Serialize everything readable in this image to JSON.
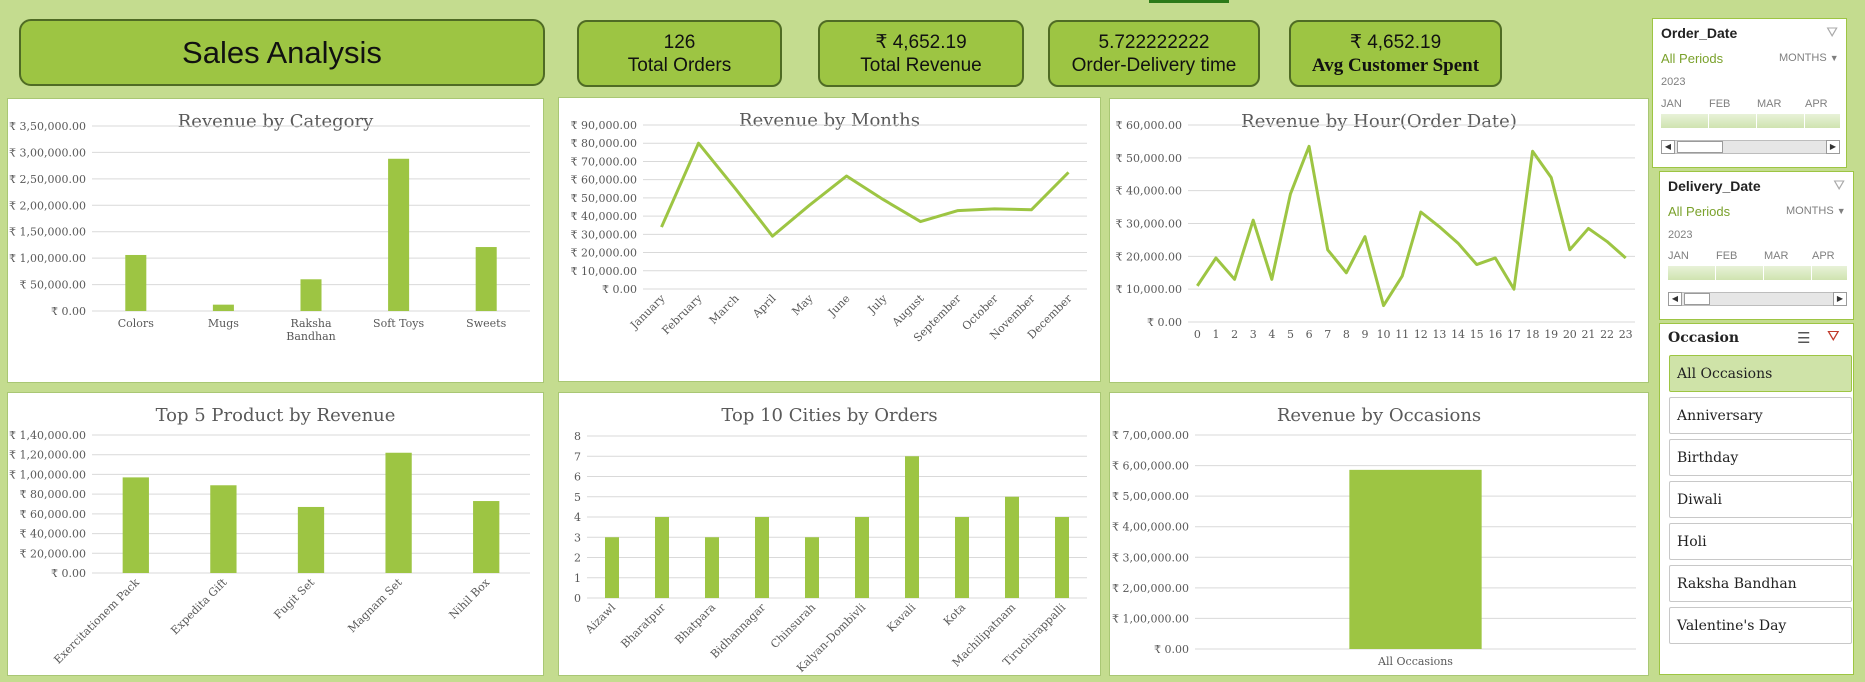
{
  "dashboard": {
    "title": "Sales Analysis"
  },
  "kpis": [
    {
      "value": "126",
      "label": "Total Orders"
    },
    {
      "value": "₹ 4,652.19",
      "label": "Total Revenue"
    },
    {
      "value": "5.722222222",
      "label": "Order-Delivery time"
    },
    {
      "value": "₹ 4,652.19",
      "label": "Avg Customer Spent"
    }
  ],
  "slicers": {
    "order_date": {
      "title": "Order_Date",
      "periods": "All Periods",
      "level": "MONTHS",
      "year": "2023",
      "months": [
        "JAN",
        "FEB",
        "MAR",
        "APR"
      ]
    },
    "delivery_date": {
      "title": "Delivery_Date",
      "periods": "All Periods",
      "level": "MONTHS",
      "year": "2023",
      "months": [
        "JAN",
        "FEB",
        "MAR",
        "APR"
      ]
    },
    "occasion": {
      "title": "Occasion",
      "items": [
        "All Occasions",
        "Anniversary",
        "Birthday",
        "Diwali",
        "Holi",
        "Raksha Bandhan",
        "Valentine's Day"
      ],
      "selected": "All Occasions"
    }
  },
  "colors": {
    "accent": "#9dc543",
    "background": "#c4dc8f",
    "border": "#4f6b24"
  },
  "chart_data": [
    {
      "id": "category",
      "type": "bar",
      "title": "Revenue by Category",
      "categories": [
        "Colors",
        "Mugs",
        "Raksha Bandhan",
        "Soft Toys",
        "Sweets"
      ],
      "values": [
        106000,
        12000,
        60000,
        288000,
        121000
      ],
      "yticks": [
        "₹ 0.00",
        "₹ 50,000.00",
        "₹ 1,00,000.00",
        "₹ 1,50,000.00",
        "₹ 2,00,000.00",
        "₹ 2,50,000.00",
        "₹ 3,00,000.00",
        "₹ 3,50,000.00"
      ],
      "ylim": [
        0,
        350000
      ]
    },
    {
      "id": "months",
      "type": "line",
      "title": "Revenue by Months",
      "categories": [
        "January",
        "February",
        "March",
        "April",
        "May",
        "June",
        "July",
        "August",
        "September",
        "October",
        "November",
        "December"
      ],
      "values": [
        34000,
        80000,
        55000,
        29000,
        46000,
        62000,
        49000,
        37000,
        43000,
        44000,
        43500,
        64000
      ],
      "yticks": [
        "₹ 0.00",
        "₹ 10,000.00",
        "₹ 20,000.00",
        "₹ 30,000.00",
        "₹ 40,000.00",
        "₹ 50,000.00",
        "₹ 60,000.00",
        "₹ 70,000.00",
        "₹ 80,000.00",
        "₹ 90,000.00"
      ],
      "ylim": [
        0,
        90000
      ]
    },
    {
      "id": "hour",
      "type": "line",
      "title": "Revenue by Hour(Order Date)",
      "categories": [
        "0",
        "1",
        "2",
        "3",
        "4",
        "5",
        "6",
        "7",
        "8",
        "9",
        "10",
        "11",
        "12",
        "13",
        "14",
        "15",
        "16",
        "17",
        "18",
        "19",
        "20",
        "21",
        "22",
        "23"
      ],
      "values": [
        11000,
        19500,
        13000,
        31000,
        13000,
        39000,
        53500,
        22000,
        15000,
        26000,
        5000,
        14000,
        33500,
        29000,
        24000,
        17500,
        19500,
        10000,
        52000,
        44000,
        22000,
        28500,
        24500,
        19500
      ],
      "yticks": [
        "₹ 0.00",
        "₹ 10,000.00",
        "₹ 20,000.00",
        "₹ 30,000.00",
        "₹ 40,000.00",
        "₹ 50,000.00",
        "₹ 60,000.00"
      ],
      "ylim": [
        0,
        60000
      ]
    },
    {
      "id": "products",
      "type": "bar",
      "title": "Top 5 Product by Revenue",
      "categories": [
        "Exercitationem Pack",
        "Expedita Gift",
        "Fugit Set",
        "Magnam Set",
        "Nihil Box"
      ],
      "values": [
        97000,
        89000,
        67000,
        122000,
        73000
      ],
      "yticks": [
        "₹ 0.00",
        "₹ 20,000.00",
        "₹ 40,000.00",
        "₹ 60,000.00",
        "₹ 80,000.00",
        "₹ 1,00,000.00",
        "₹ 1,20,000.00",
        "₹ 1,40,000.00"
      ],
      "ylim": [
        0,
        140000
      ]
    },
    {
      "id": "cities",
      "type": "bar",
      "title": "Top 10 Cities by Orders",
      "categories": [
        "Aizawl",
        "Bharatpur",
        "Bhatpara",
        "Bidhannagar",
        "Chinsurah",
        "Kalyan-Dombivli",
        "Kavali",
        "Kota",
        "Machilipatnam",
        "Tiruchirappalli"
      ],
      "values": [
        3,
        4,
        3,
        4,
        3,
        4,
        7,
        4,
        5,
        4
      ],
      "yticks": [
        "0",
        "1",
        "2",
        "3",
        "4",
        "5",
        "6",
        "7",
        "8"
      ],
      "ylim": [
        0,
        8
      ]
    },
    {
      "id": "occasions",
      "type": "bar",
      "title": "Revenue by Occasions",
      "categories": [
        "All Occasions"
      ],
      "values": [
        586000
      ],
      "yticks": [
        "₹ 0.00",
        "₹ 1,00,000.00",
        "₹ 2,00,000.00",
        "₹ 3,00,000.00",
        "₹ 4,00,000.00",
        "₹ 5,00,000.00",
        "₹ 6,00,000.00",
        "₹ 7,00,000.00"
      ],
      "ylim": [
        0,
        700000
      ]
    }
  ]
}
